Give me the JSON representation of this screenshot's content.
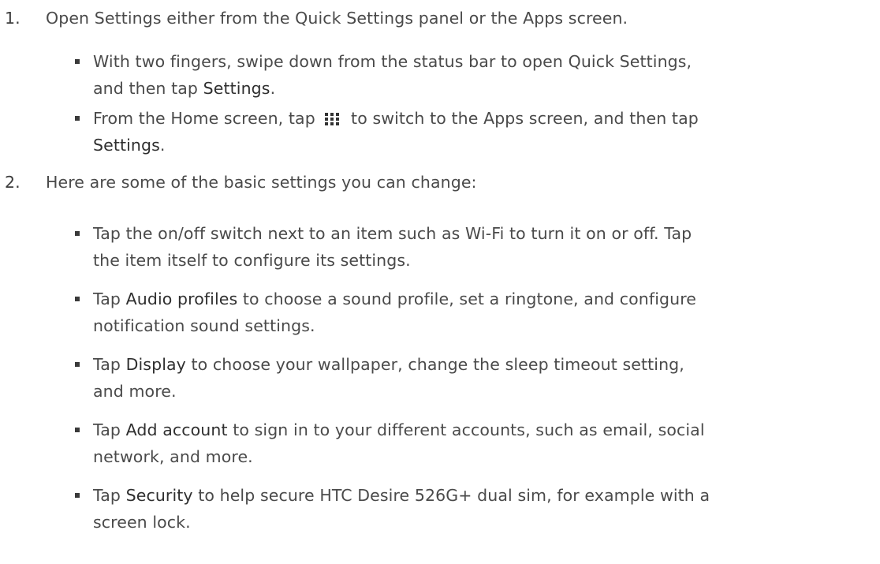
{
  "steps": [
    {
      "number": "1.",
      "text": "Open Settings either from the Quick Settings panel or the Apps screen.",
      "bullets": [
        {
          "line1_pre": "With two fingers, swipe down from the status bar to open Quick Settings,",
          "line2_pre": "and then tap ",
          "line2_bold": "Settings",
          "line2_post": "."
        },
        {
          "line1_pre": "From the Home screen, tap ",
          "icon": "apps-grid-icon",
          "line1_post": " to switch to the Apps screen, and then tap",
          "line2_bold": "Settings",
          "line2_post": "."
        }
      ]
    },
    {
      "number": "2.",
      "text": "Here are some of the basic settings you can change:",
      "bullets": [
        {
          "line1_pre": "Tap the on/off switch next to an item such as Wi-Fi to turn it on or off. Tap",
          "line2_pre": "the item itself to configure its settings."
        },
        {
          "line1_pre": "Tap ",
          "line1_bold": "Audio profiles",
          "line1_post": " to choose a sound profile, set a ringtone, and configure",
          "line2_pre": "notification sound settings."
        },
        {
          "line1_pre": "Tap ",
          "line1_bold": "Display",
          "line1_post": " to choose your wallpaper, change the sleep timeout setting,",
          "line2_pre": "and more."
        },
        {
          "line1_pre": "Tap ",
          "line1_bold": "Add account",
          "line1_post": " to sign in to your different accounts, such as email, social",
          "line2_pre": "network, and more."
        },
        {
          "line1_pre": "Tap ",
          "line1_bold": "Security",
          "line1_post": " to help secure HTC Desire 526G+ dual sim, for example with a",
          "line2_pre": "screen lock."
        }
      ]
    }
  ]
}
